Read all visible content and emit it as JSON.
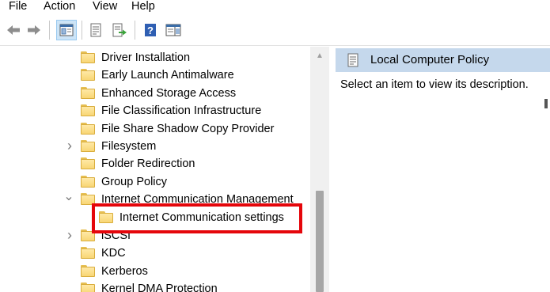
{
  "menubar": {
    "items": [
      "File",
      "Action",
      "View",
      "Help"
    ]
  },
  "toolbar": {
    "buttons": [
      {
        "icon": "back-arrow-icon"
      },
      {
        "icon": "forward-arrow-icon"
      },
      {
        "icon": "show-hide-console-tree-icon",
        "pressed": true
      },
      {
        "icon": "properties-icon"
      },
      {
        "icon": "export-list-icon"
      },
      {
        "icon": "help-icon"
      },
      {
        "icon": "show-hide-action-pane-icon"
      }
    ]
  },
  "tree": {
    "items": [
      {
        "label": "Driver Installation",
        "toggle": ""
      },
      {
        "label": "Early Launch Antimalware",
        "toggle": ""
      },
      {
        "label": "Enhanced Storage Access",
        "toggle": ""
      },
      {
        "label": "File Classification Infrastructure",
        "toggle": ""
      },
      {
        "label": "File Share Shadow Copy Provider",
        "toggle": ""
      },
      {
        "label": "Filesystem",
        "toggle": "›"
      },
      {
        "label": "Folder Redirection",
        "toggle": ""
      },
      {
        "label": "Group Policy",
        "toggle": ""
      },
      {
        "label": "Internet Communication Management",
        "toggle": "⌄"
      },
      {
        "label": "Internet Communication settings",
        "toggle": ""
      },
      {
        "label": "iSCSI",
        "toggle": "›"
      },
      {
        "label": "KDC",
        "toggle": ""
      },
      {
        "label": "Kerberos",
        "toggle": ""
      },
      {
        "label": "Kernel DMA Protection",
        "toggle": ""
      }
    ]
  },
  "right_pane": {
    "title": "Local Computer Policy",
    "description": "Select an item to view its description."
  },
  "colors": {
    "highlight": "#e5060b",
    "header_bg": "#c5d8ec",
    "folder": "#f8d675"
  }
}
